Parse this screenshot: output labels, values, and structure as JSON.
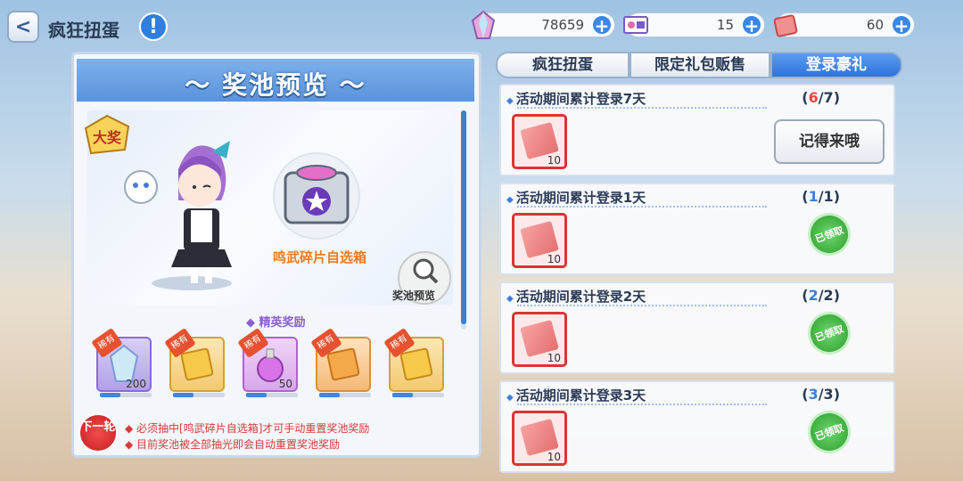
{
  "header": {
    "title": "疯狂扭蛋",
    "info_glyph": "!",
    "back_glyph": "<",
    "resources": [
      {
        "name": "crystal",
        "value": "78659"
      },
      {
        "name": "ticket",
        "value": "15"
      },
      {
        "name": "shard",
        "value": "60"
      }
    ],
    "plus_glyph": "+"
  },
  "pool": {
    "title": "〜 奖池预览 〜",
    "grand_badge": "大奖",
    "box_label": "鸣武碎片自选箱",
    "preview_label": "奖池预览",
    "elite_label": "◆ 精英奖励",
    "rare_tag": "稀有",
    "rewards": [
      {
        "count": "200",
        "color": "#8a6ae0"
      },
      {
        "count": "",
        "color": "#f0b430"
      },
      {
        "count": "50",
        "color": "#c060e0"
      },
      {
        "count": "",
        "color": "#f09a30"
      },
      {
        "count": "",
        "color": "#f0b430"
      }
    ],
    "next_round": "下一轮",
    "notes": [
      "◆ 必须抽中[鸣武碎片自选箱]才可手动重置奖池奖励",
      "◆ 目前奖池被全部抽光即会自动重置奖池奖励"
    ]
  },
  "tabs": [
    {
      "label": "疯狂扭蛋",
      "active": false
    },
    {
      "label": "限定礼包贩售",
      "active": false
    },
    {
      "label": "登录豪礼",
      "active": true
    }
  ],
  "missions": [
    {
      "title": "活动期间累计登录7天",
      "current": "6",
      "total": "7",
      "item_count": "10",
      "action": "记得来哦",
      "claimed": false
    },
    {
      "title": "活动期间累计登录1天",
      "current": "1",
      "total": "1",
      "item_count": "10",
      "action": "已领取",
      "claimed": true
    },
    {
      "title": "活动期间累计登录2天",
      "current": "2",
      "total": "2",
      "item_count": "10",
      "action": "已领取",
      "claimed": true
    },
    {
      "title": "活动期间累计登录3天",
      "current": "3",
      "total": "3",
      "item_count": "10",
      "action": "已领取",
      "claimed": true
    }
  ],
  "colors": {
    "accent": "#3b7fd8",
    "alert": "#d63a3a",
    "claimed": "#2ba02b",
    "frame": "#d33333"
  }
}
